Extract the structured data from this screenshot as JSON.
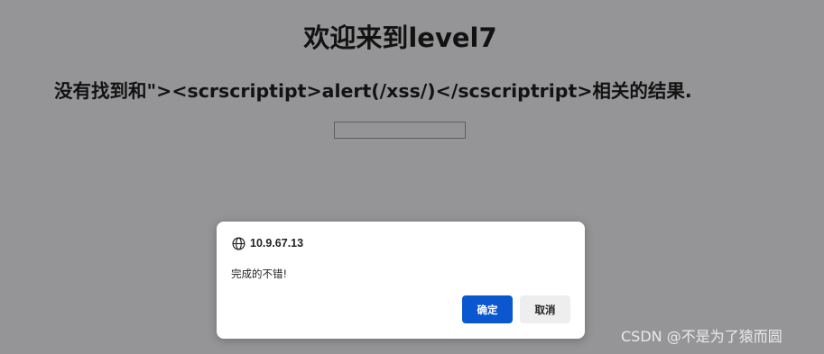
{
  "page": {
    "title": "欢迎来到level7",
    "result_text": "没有找到和\"><scrscriptipt>alert(/xss/)</scscriptript>相关的结果.",
    "search_value": ""
  },
  "dialog": {
    "origin": "10.9.67.13",
    "origin_icon": "globe-icon",
    "message": "完成的不错!",
    "ok_label": "确定",
    "cancel_label": "取消"
  },
  "watermark": {
    "text": "CSDN @不是为了猿而圆"
  },
  "colors": {
    "overlay_background": "#959597",
    "primary_button": "#0b57d0",
    "secondary_button": "#eeeeee"
  }
}
